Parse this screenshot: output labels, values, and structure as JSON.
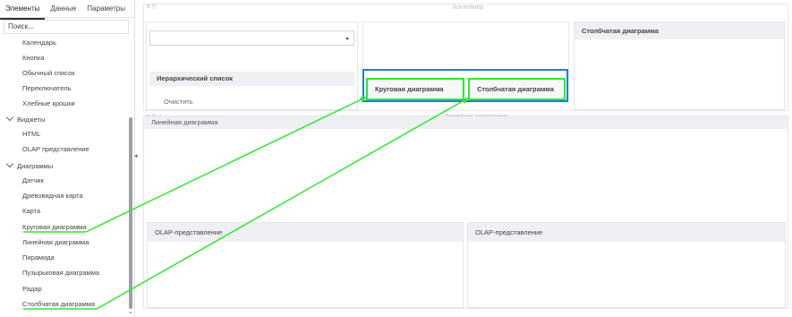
{
  "sidebar": {
    "tabs": [
      "Элементы",
      "Данные",
      "Параметры"
    ],
    "search_placeholder": "Поиск...",
    "items": [
      {
        "label": "Календарь"
      },
      {
        "label": "Кнопка"
      },
      {
        "label": "Обычный список"
      },
      {
        "label": "Переключатель"
      },
      {
        "label": "Хлебные крошки"
      }
    ],
    "group_widgets": "Виджеты",
    "widget_items": [
      {
        "label": "HTML"
      },
      {
        "label": "OLAP представление"
      }
    ],
    "group_charts": "Диаграммы",
    "chart_items": [
      {
        "label": "Датчик"
      },
      {
        "label": "Древовидная карта"
      },
      {
        "label": "Карта"
      },
      {
        "label": "Круговая диаграмма"
      },
      {
        "label": "Линейная диаграмма"
      },
      {
        "label": "Пирамида"
      },
      {
        "label": "Пузырьковая диаграмма"
      },
      {
        "label": "Радар"
      },
      {
        "label": "Столбчатая диаграмма"
      }
    ]
  },
  "canvas": {
    "container_label": "Контейнер",
    "container_label_2": "Линейная диаграмма",
    "hierarchy_title": "Иерархический список",
    "clear_label": "Очистить",
    "pie_title": "Круговая диаграмма",
    "bar_title": "Столбчатая диаграмма",
    "bar_title_right": "Столбчатая диаграмма",
    "line_title": "Линейная диаграмма",
    "olap_left_title": "OLAP-представление",
    "olap_right_title": "OLAP-представление"
  },
  "colors": {
    "highlight_blue": "#1a7fe0",
    "highlight_green": "#2ee82e"
  },
  "icons": {
    "dropdown": "chevron-down-icon",
    "group_toggle": "chevron-down-icon",
    "collapse": "chevron-left-icon",
    "scroll": "chevron-down-icon"
  }
}
